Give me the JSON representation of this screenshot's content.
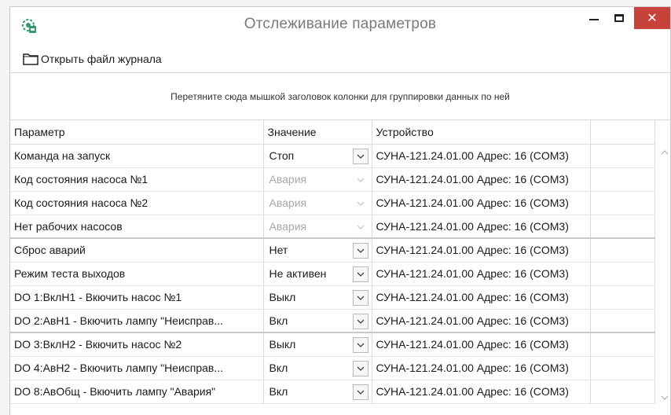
{
  "window": {
    "title": "Отслеживание параметров",
    "close_glyph": "✕"
  },
  "toolbar": {
    "open_log_label": "Открыть файл журнала"
  },
  "group_panel": {
    "hint": "Перетяните сюда мышкой заголовок колонки для группировки данных по ней"
  },
  "grid": {
    "columns": [
      "Параметр",
      "Значение",
      "Устройство"
    ],
    "rows": [
      {
        "param": "Команда на запуск",
        "value": "Стоп",
        "device": "СУНА-121.24.01.00 Адрес: 16 (COM3)",
        "enabled": true
      },
      {
        "param": "Код состояния насоса №1",
        "value": "Авария",
        "device": "СУНА-121.24.01.00 Адрес: 16 (COM3)",
        "enabled": false
      },
      {
        "param": "Код состояния насоса №2",
        "value": "Авария",
        "device": "СУНА-121.24.01.00 Адрес: 16 (COM3)",
        "enabled": false
      },
      {
        "param": "Нет рабочих насосов",
        "value": "Авария",
        "device": "СУНА-121.24.01.00 Адрес: 16 (COM3)",
        "enabled": false
      },
      {
        "param": "Сброс аварий",
        "value": "Нет",
        "device": "СУНА-121.24.01.00 Адрес: 16 (COM3)",
        "enabled": true
      },
      {
        "param": "Режим теста выходов",
        "value": "Не активен",
        "device": "СУНА-121.24.01.00 Адрес: 16 (COM3)",
        "enabled": true
      },
      {
        "param": "DO 1:ВклН1 - Вкючить насос №1",
        "value": "Выкл",
        "device": "СУНА-121.24.01.00 Адрес: 16 (COM3)",
        "enabled": true
      },
      {
        "param": "DO 2:АвН1 - Вкючить лампу \"Неисправ...",
        "value": "Вкл",
        "device": "СУНА-121.24.01.00 Адрес: 16 (COM3)",
        "enabled": true
      },
      {
        "param": "DO 3:ВклН2 - Вкючить насос №2",
        "value": "Выкл",
        "device": "СУНА-121.24.01.00 Адрес: 16 (COM3)",
        "enabled": true
      },
      {
        "param": "DO 4:АвН2 - Вкючить лампу \"Неисправ...",
        "value": "Вкл",
        "device": "СУНА-121.24.01.00 Адрес: 16 (COM3)",
        "enabled": true
      },
      {
        "param": "DO 8:АвОбщ - Вкючить лампу \"Авария\"",
        "value": "Вкл",
        "device": "СУНА-121.24.01.00 Адрес: 16 (COM3)",
        "enabled": true
      }
    ]
  },
  "colors": {
    "close_button": "#c7423a",
    "app_icon": "#2f9b6b",
    "muted_text": "#a8a8a8"
  },
  "icons": {
    "app": "app-icon",
    "folder": "folder-icon",
    "minimize": "minimize-icon",
    "maximize": "maximize-icon",
    "close": "close-icon",
    "dropdown": "chevron-down-icon"
  }
}
